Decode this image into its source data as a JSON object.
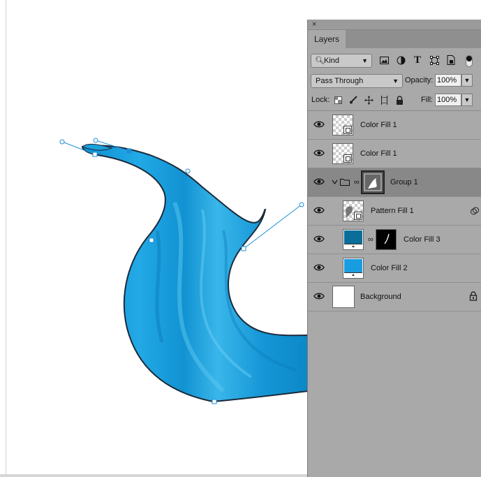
{
  "canvas": {
    "shape_color": "#1aa0dc",
    "path_color": "#1f8fd6"
  },
  "panel": {
    "close_glyph": "×",
    "tab_label": "Layers",
    "filter": {
      "kind_label": "Kind",
      "icons": [
        "image-filter-icon",
        "adjustment-filter-icon",
        "type-filter-icon",
        "shape-filter-icon",
        "smart-object-filter-icon"
      ]
    },
    "blend_mode": "Pass Through",
    "opacity_label": "Opacity:",
    "opacity_value": "100%",
    "lock_label": "Lock:",
    "fill_label": "Fill:",
    "fill_value": "100%",
    "layers": [
      {
        "name": "Color Fill 1",
        "visible": true,
        "type": "smart-object"
      },
      {
        "name": "Color Fill 1",
        "visible": true,
        "type": "smart-object"
      },
      {
        "name": "Group 1",
        "visible": true,
        "type": "group",
        "selected": true
      },
      {
        "name": "Pattern Fill 1",
        "visible": true,
        "type": "pattern-fill"
      },
      {
        "name": "Color Fill 3",
        "visible": true,
        "type": "color-fill",
        "color": "#0a6e99"
      },
      {
        "name": "Color Fill 2",
        "visible": true,
        "type": "color-fill",
        "color": "#1a9de0"
      },
      {
        "name": "Background",
        "visible": true,
        "type": "background",
        "locked": true
      }
    ]
  }
}
